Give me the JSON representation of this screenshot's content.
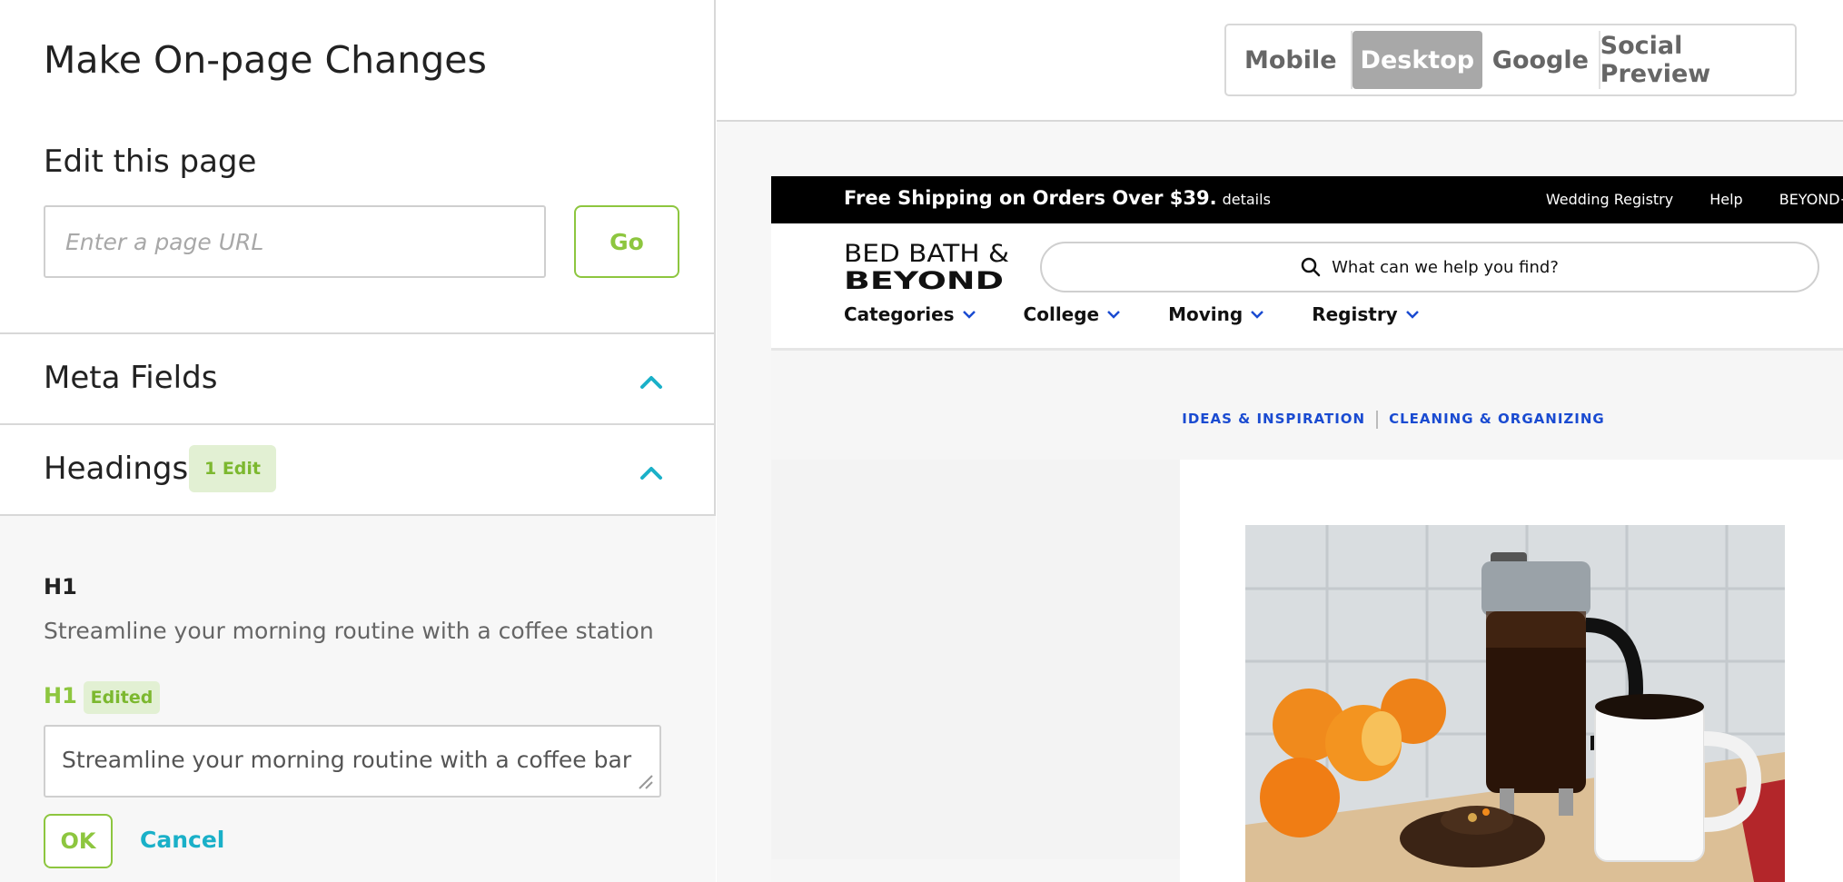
{
  "left": {
    "title": "Make On-page Changes",
    "edit_label": "Edit this page",
    "url_placeholder": "Enter a page URL",
    "go_label": "Go",
    "meta_fields": "Meta Fields",
    "headings": "Headings",
    "headings_badge": "1 Edit",
    "original_h1_label": "H1",
    "original_h1_text": "Streamline your morning routine with a coffee station",
    "edited_h1_label": "H1",
    "edited_badge": "Edited",
    "edited_h1_value": "Streamline your morning routine with a coffee bar",
    "ok_label": "OK",
    "cancel_label": "Cancel"
  },
  "preview_tabs": [
    {
      "label": "Mobile",
      "active": false
    },
    {
      "label": "Desktop",
      "active": true
    },
    {
      "label": "Google",
      "active": false
    },
    {
      "label": "Social Preview",
      "active": false
    }
  ],
  "site": {
    "promo_text": "Free Shipping on Orders Over $39.",
    "promo_details": "details",
    "top_links": [
      "Wedding Registry",
      "Help",
      "BEYOND+"
    ],
    "logo_line1": "BED BATH &",
    "logo_line2": "BEYOND",
    "search_placeholder": "What can we help you find?",
    "nav": [
      "Categories",
      "College",
      "Moving",
      "Registry"
    ],
    "breadcrumbs": [
      "IDEAS & INSPIRATION",
      "CLEANING & ORGANIZING"
    ]
  },
  "colors": {
    "accent_green": "#8dc63f",
    "accent_teal": "#1ab0c8",
    "site_link_blue": "#1a4bd1"
  }
}
